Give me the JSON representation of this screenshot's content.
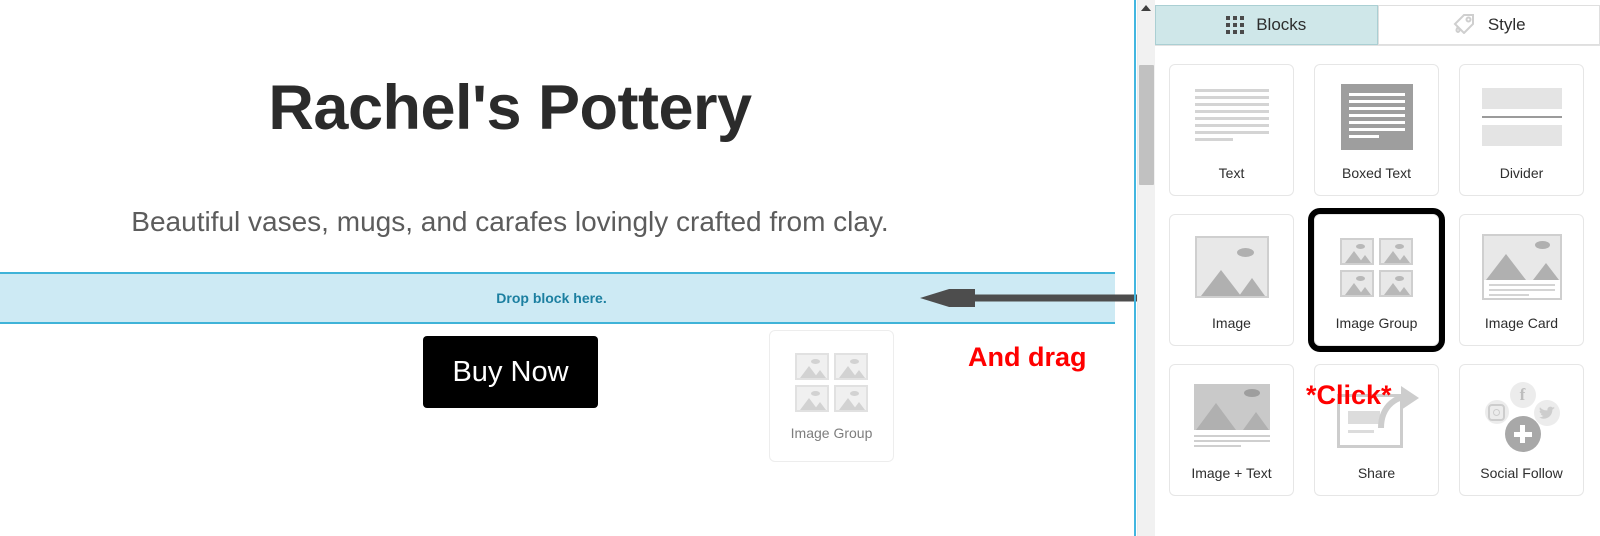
{
  "canvas": {
    "site_title": "Rachel's Pottery",
    "tagline": "Beautiful vases, mugs, and carafes lovingly crafted from clay.",
    "drop_zone_label": "Drop block here.",
    "buy_now_label": "Buy Now",
    "drag_ghost_label": "Image Group"
  },
  "annotations": {
    "and_drag": "And drag",
    "click": "*Click*",
    "arrow_icon": "left-arrow-icon",
    "annotation_color": "#ff0000",
    "arrow_color": "#4d4d4d"
  },
  "panel": {
    "tabs": [
      {
        "label": "Blocks",
        "icon": "grid-dots-icon",
        "active": true
      },
      {
        "label": "Style",
        "icon": "paint-tag-icon",
        "active": false
      }
    ],
    "blocks": [
      {
        "label": "Text",
        "icon": "text-lines-icon",
        "selected": false
      },
      {
        "label": "Boxed Text",
        "icon": "boxed-text-icon",
        "selected": false
      },
      {
        "label": "Divider",
        "icon": "divider-icon",
        "selected": false
      },
      {
        "label": "Image",
        "icon": "image-icon",
        "selected": false
      },
      {
        "label": "Image Group",
        "icon": "image-group-icon",
        "selected": true
      },
      {
        "label": "Image Card",
        "icon": "image-card-icon",
        "selected": false
      },
      {
        "label": "Image + Text",
        "icon": "image-text-icon",
        "selected": false
      },
      {
        "label": "Share",
        "icon": "share-icon",
        "selected": false
      },
      {
        "label": "Social Follow",
        "icon": "social-follow-icon",
        "selected": false
      }
    ],
    "scrollbar": {
      "icon": "scroll-up-arrow-icon"
    },
    "accent_color": "#42b6e0",
    "active_tab_color": "#cfe7e9"
  }
}
